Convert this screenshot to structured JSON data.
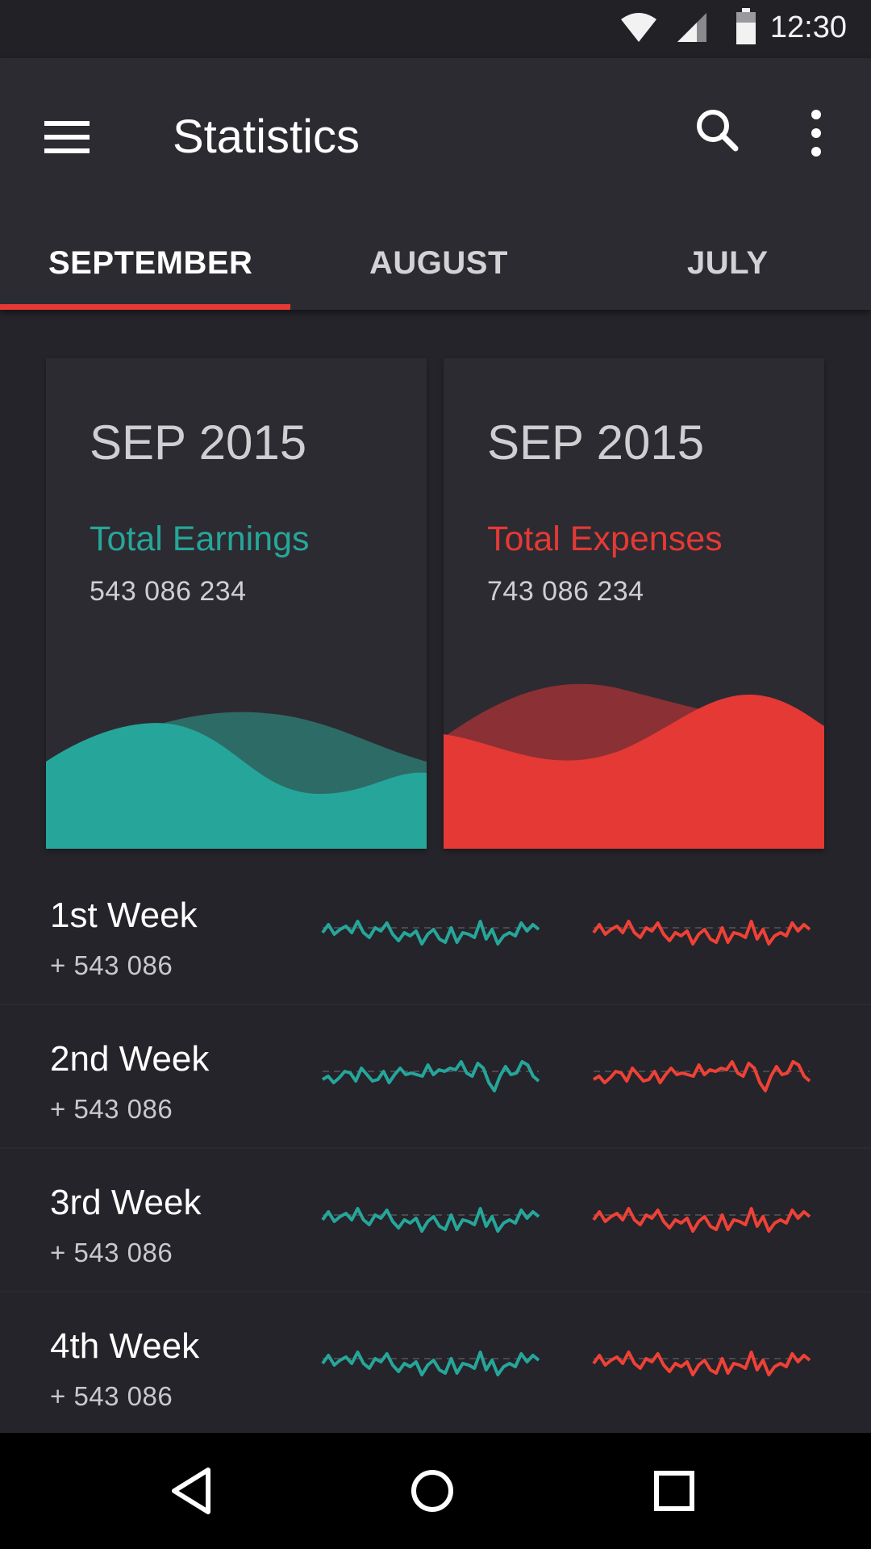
{
  "status_bar": {
    "time": "12:30",
    "icons": [
      "wifi-icon",
      "cell-signal-icon",
      "battery-icon"
    ]
  },
  "app_bar": {
    "title": "Statistics",
    "icons": [
      "menu-icon",
      "search-icon",
      "more-vert-icon"
    ]
  },
  "tabs": [
    {
      "label": "SEPTEMBER",
      "active": true
    },
    {
      "label": "AUGUST",
      "active": false
    },
    {
      "label": "JULY",
      "active": false
    }
  ],
  "colors": {
    "accent_red": "#e53935",
    "earnings_teal": "#26a69a",
    "earnings_teal_dark": "#2d6b67",
    "expenses_red_dark": "#8b3034",
    "sparkline_teal": "#26a69a",
    "sparkline_red": "#ef4136",
    "background": "#25242a",
    "surface": "#2c2b31"
  },
  "cards": [
    {
      "period": "SEP 2015",
      "label": "Total Earnings",
      "amount": "543 086 234",
      "color": "#26a69a"
    },
    {
      "period": "SEP 2015",
      "label": "Total Expenses",
      "amount": "743 086 234",
      "color": "#e53935"
    }
  ],
  "weeks": [
    {
      "name": "1st Week",
      "value": "+ 543 086"
    },
    {
      "name": "2nd Week",
      "value": "+ 543 086"
    },
    {
      "name": "3rd Week",
      "value": "+ 543 086"
    },
    {
      "name": "4th Week",
      "value": "+ 543 086"
    }
  ],
  "nav_bar": {
    "icons": [
      "back-icon",
      "home-icon",
      "recents-icon"
    ]
  }
}
